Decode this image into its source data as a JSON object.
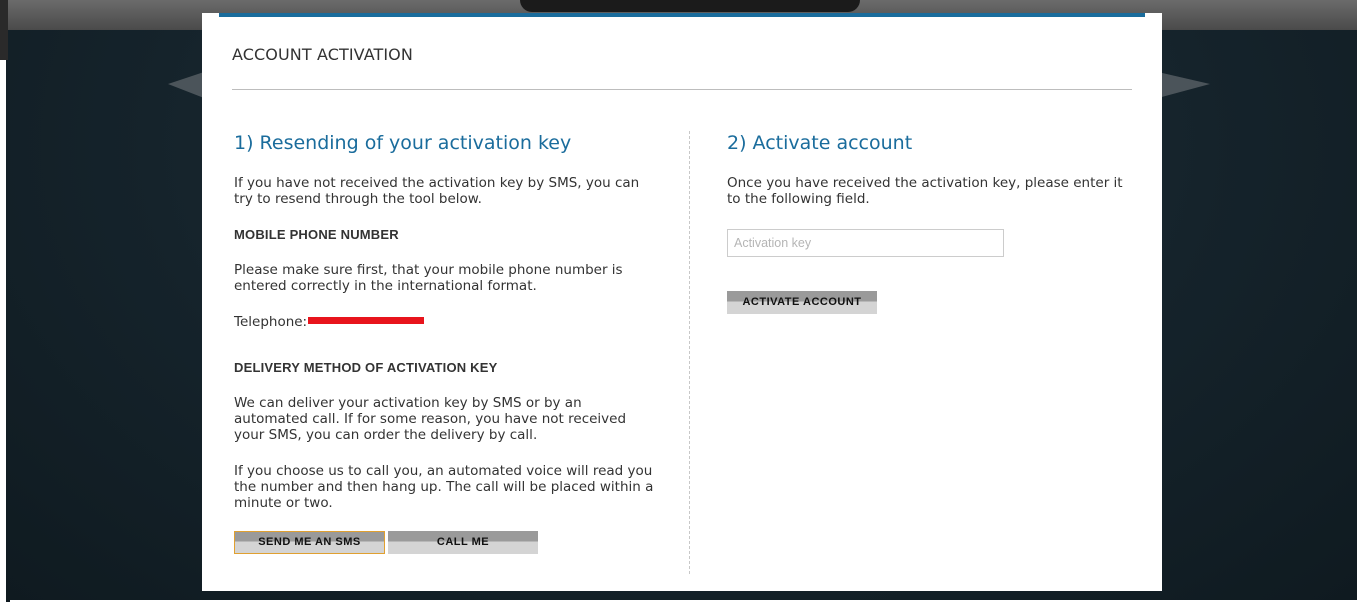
{
  "modal": {
    "title": "ACCOUNT ACTIVATION",
    "accent_color": "#1a6c9c"
  },
  "resend": {
    "heading": "1) Resending of your activation key",
    "intro": "If you have not received the activation key by SMS, you can try to resend through the tool below.",
    "phone_heading": "MOBILE PHONE NUMBER",
    "phone_note": "Please make sure first, that your mobile phone number is entered correctly in the international format.",
    "telephone_label": "Telephone:",
    "delivery_heading": "DELIVERY METHOD OF ACTIVATION KEY",
    "delivery_text_1": "We can deliver your activation key by SMS or by an automated call. If for some reason, you have not received your SMS, you can order the delivery by call.",
    "delivery_text_2": "If you choose us to call you, an automated voice will read you the number and then hang up. The call will be placed within a minute or two.",
    "sms_button": "SEND ME AN SMS",
    "call_button": "CALL ME"
  },
  "activate": {
    "heading": "2) Activate account",
    "intro": "Once you have received the activation key, please enter it to the following field.",
    "key_input_placeholder": "Activation key",
    "key_input_value": "",
    "activate_button": "ACTIVATE ACCOUNT"
  }
}
